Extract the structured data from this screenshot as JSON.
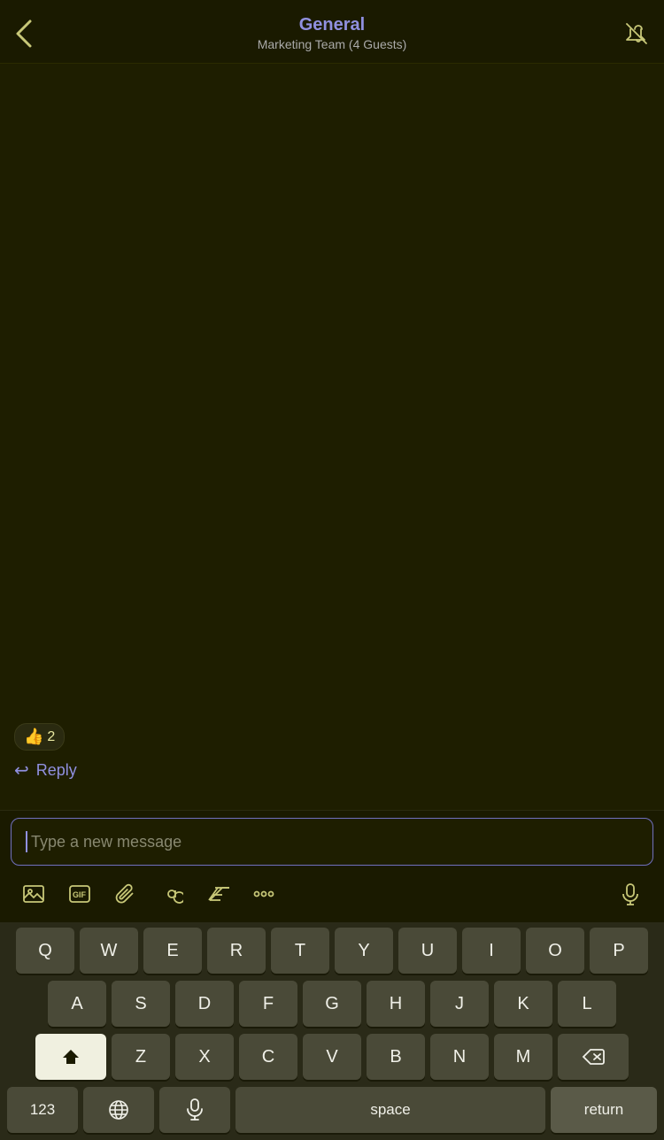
{
  "header": {
    "title": "General",
    "subtitle": "Marketing Team (4 Guests)",
    "back_label": "‹",
    "mute_label": "🔕"
  },
  "chat": {
    "reaction_emoji": "👍",
    "reaction_count": "2",
    "reply_arrow": "↩",
    "reply_label": "Reply"
  },
  "input": {
    "placeholder": "Type a new message"
  },
  "toolbar": {
    "icons": [
      "image",
      "gif",
      "paperclip",
      "mention",
      "font",
      "more",
      "mic"
    ]
  },
  "keyboard": {
    "row1": [
      "Q",
      "W",
      "E",
      "R",
      "T",
      "Y",
      "U",
      "I",
      "O",
      "P"
    ],
    "row2": [
      "A",
      "S",
      "D",
      "F",
      "G",
      "H",
      "J",
      "K",
      "L"
    ],
    "row3": [
      "Z",
      "X",
      "C",
      "V",
      "B",
      "N",
      "M"
    ],
    "bottom": {
      "num_label": "123",
      "space_label": "space",
      "return_label": "return"
    }
  },
  "colors": {
    "bg": "#1e1e00",
    "header_bg": "#1a1a00",
    "accent_purple": "#9090e0",
    "accent_yellow": "#c8c878",
    "key_bg": "#4a4a38",
    "keyboard_bg": "#2a2a18"
  }
}
